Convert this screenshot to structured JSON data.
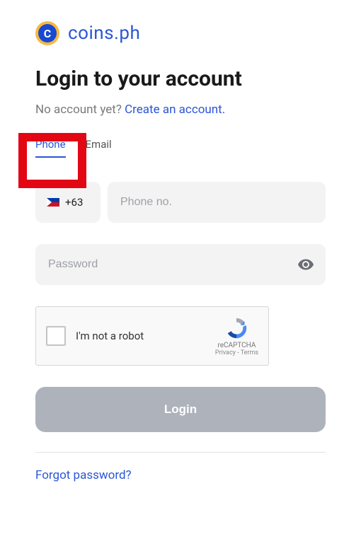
{
  "brand": {
    "glyph": "C",
    "name": "coins.ph"
  },
  "heading": "Login to your account",
  "no_account": {
    "prefix": "No account yet? ",
    "link": "Create an account."
  },
  "tabs": {
    "phone": "Phone",
    "email": "Email"
  },
  "phone": {
    "country_code": "+63",
    "country_name": "Philippines",
    "placeholder": "Phone no."
  },
  "password": {
    "placeholder": "Password"
  },
  "recaptcha": {
    "label": "I'm not a robot",
    "brand": "reCAPTCHA",
    "privacy": "Privacy",
    "terms": "Terms",
    "separator": " - "
  },
  "login_label": "Login",
  "forgot_label": "Forgot password?"
}
